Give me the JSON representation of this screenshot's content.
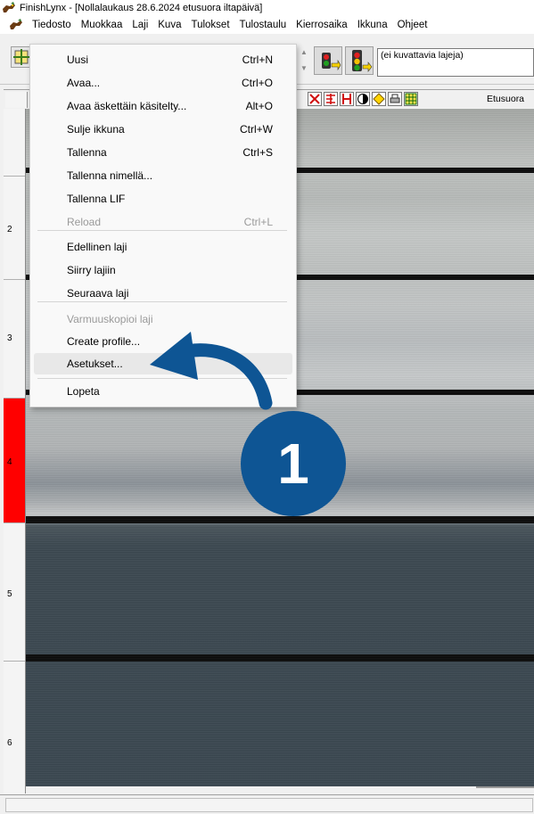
{
  "window": {
    "title": "FinishLynx - [Nollalaukaus 28.6.2024 etusuora iltapäivä]"
  },
  "menubar": {
    "items": [
      "Tiedosto",
      "Muokkaa",
      "Laji",
      "Kuva",
      "Tulokset",
      "Tulostaulu",
      "Kierrosaika",
      "Ikkuna",
      "Ohjeet"
    ]
  },
  "toolbar": {
    "race_list_text": "(ei kuvattavia lajeja)"
  },
  "image_window": {
    "camera_label": "Etusuora",
    "lane_numbers": [
      "2",
      "3",
      "4",
      "5",
      "6"
    ],
    "highlighted_lane": "4",
    "highlight_color": "#ff0000"
  },
  "file_menu": {
    "items": [
      {
        "label": "Uusi",
        "shortcut": "Ctrl+N"
      },
      {
        "label": "Avaa...",
        "shortcut": "Ctrl+O"
      },
      {
        "label": "Avaa äskettäin käsitelty...",
        "shortcut": "Alt+O"
      },
      {
        "label": "Sulje ikkuna",
        "shortcut": "Ctrl+W"
      },
      {
        "label": "Tallenna",
        "shortcut": "Ctrl+S"
      },
      {
        "label": "Tallenna nimellä...",
        "shortcut": ""
      },
      {
        "label": "Tallenna LIF",
        "shortcut": ""
      },
      {
        "label": "Reload",
        "shortcut": "Ctrl+L",
        "disabled": true
      },
      {
        "label": "Edellinen laji",
        "shortcut": ""
      },
      {
        "label": "Siirry lajiin",
        "shortcut": ""
      },
      {
        "label": "Seuraava laji",
        "shortcut": ""
      },
      {
        "label": "Varmuuskopioi laji",
        "shortcut": "",
        "disabled": true
      },
      {
        "label": "Create profile...",
        "shortcut": ""
      },
      {
        "label": "Asetukset...",
        "shortcut": "",
        "highlighted": true
      },
      {
        "label": "Lopeta",
        "shortcut": ""
      }
    ]
  },
  "annotation": {
    "step_number": "1",
    "color": "#0e5594"
  }
}
